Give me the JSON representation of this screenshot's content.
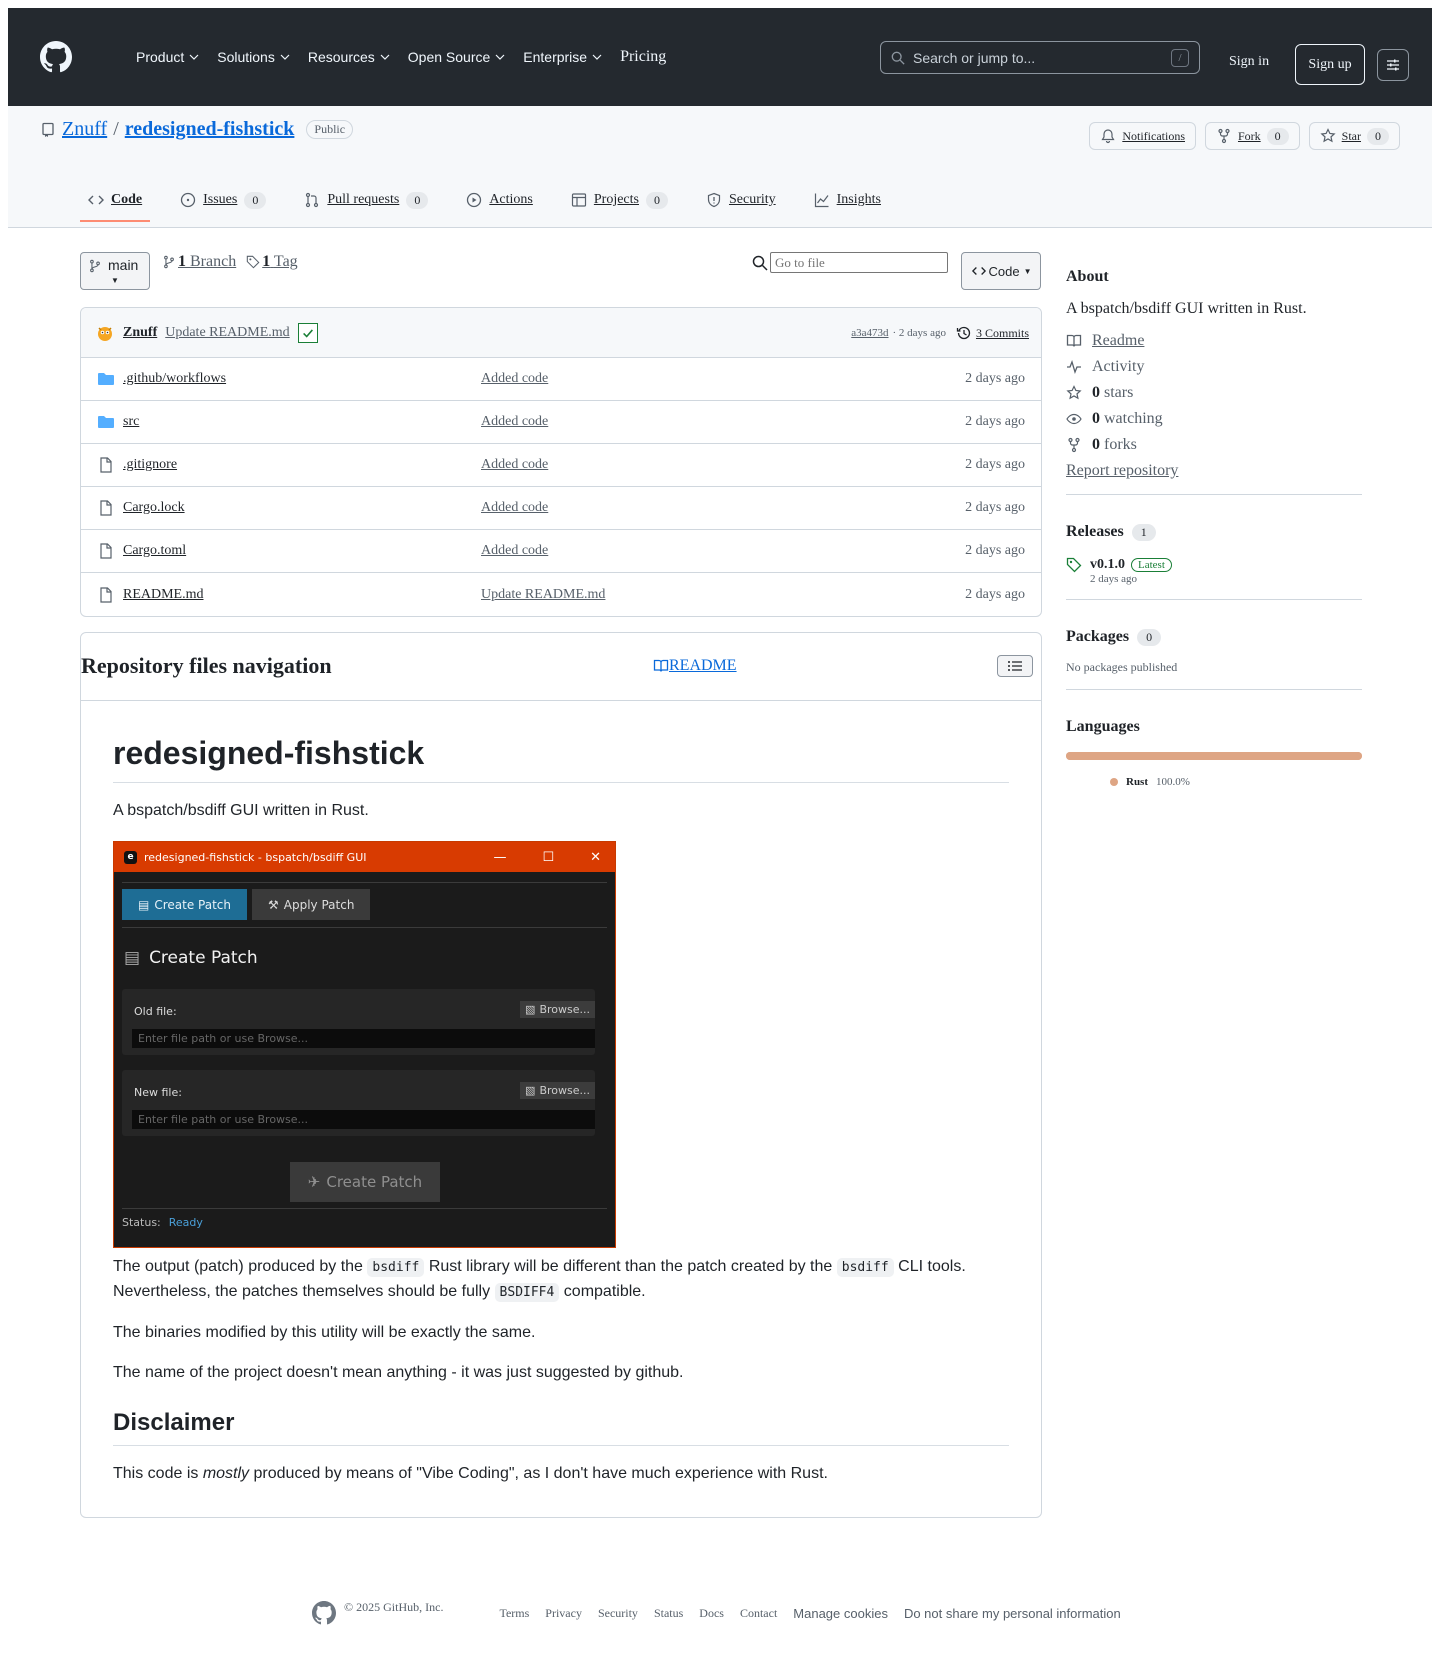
{
  "header": {
    "nav": [
      "Product",
      "Solutions",
      "Resources",
      "Open Source",
      "Enterprise"
    ],
    "pricing": "Pricing",
    "search_placeholder": "Search or jump to...",
    "search_shortcut": "/",
    "sign_in": "Sign in",
    "sign_up": "Sign up"
  },
  "repo": {
    "owner": "Znuff",
    "separator": "/",
    "name": "redesigned-fishstick",
    "visibility": "Public",
    "actions": {
      "notifications": "Notifications",
      "fork": "Fork",
      "fork_count": "0",
      "star": "Star",
      "star_count": "0"
    },
    "tabs": [
      {
        "label": "Code",
        "count": ""
      },
      {
        "label": "Issues",
        "count": "0"
      },
      {
        "label": "Pull requests",
        "count": "0"
      },
      {
        "label": "Actions",
        "count": ""
      },
      {
        "label": "Projects",
        "count": "0"
      },
      {
        "label": "Security",
        "count": ""
      },
      {
        "label": "Insights",
        "count": ""
      }
    ]
  },
  "browser": {
    "branch": "main",
    "branches_count": "1",
    "branches_label": "Branch",
    "tags_count": "1",
    "tags_label": "Tag",
    "goto_placeholder": "Go to file",
    "code_button": "Code",
    "commit": {
      "author": "Znuff",
      "message": "Update README.md",
      "sha": "a3a473d",
      "age": "· 2 days ago",
      "commits": "3 Commits"
    },
    "files": [
      {
        "name": ".github/workflows",
        "type": "dir",
        "message": "Added code",
        "age": "2 days ago"
      },
      {
        "name": "src",
        "type": "dir",
        "message": "Added code",
        "age": "2 days ago"
      },
      {
        "name": ".gitignore",
        "type": "file",
        "message": "Added code",
        "age": "2 days ago"
      },
      {
        "name": "Cargo.lock",
        "type": "file",
        "message": "Added code",
        "age": "2 days ago"
      },
      {
        "name": "Cargo.toml",
        "type": "file",
        "message": "Added code",
        "age": "2 days ago"
      },
      {
        "name": "README.md",
        "type": "file",
        "message": "Update README.md",
        "age": "2 days ago"
      }
    ]
  },
  "readme": {
    "nav_title": "Repository files navigation",
    "nav_link": "README",
    "title": "redesigned-fishstick",
    "intro": "A bspatch/bsdiff GUI written in Rust.",
    "p1_a": "The output (patch) produced by the",
    "p1_code1": "bsdiff",
    "p1_b": "Rust library will be different than the patch created by the",
    "p1_code2": "bsdiff",
    "p1_c": "CLI tools.",
    "p1_d": "Nevertheless, the patches themselves should be fully",
    "p1_code3": "BSDIFF4",
    "p1_e": "compatible.",
    "p2": "The binaries modified by this utility will be exactly the same.",
    "p3": "The name of the project doesn't mean anything - it was just suggested by github.",
    "h2": "Disclaimer",
    "p4_a": "This code is",
    "p4_em": "mostly",
    "p4_b": "produced by means of \"Vibe Coding\", as I don't have much experience with Rust."
  },
  "screenshot": {
    "app_icon": "e",
    "window_title": "redesigned-fishstick - bspatch/bsdiff GUI",
    "tab_create": "Create Patch",
    "tab_apply": "Apply Patch",
    "heading": "Create Patch",
    "old_label": "Old file:",
    "new_label": "New file:",
    "browse": "Browse...",
    "input_placeholder": "Enter file path or use Browse...",
    "create_button": "Create Patch",
    "status_label": "Status:",
    "status_value": "Ready"
  },
  "sidebar": {
    "about_title": "About",
    "description": "A bspatch/bsdiff GUI written in Rust.",
    "readme": "Readme",
    "activity": "Activity",
    "stars_count": "0",
    "stars_label": "stars",
    "watching_count": "0",
    "watching_label": "watching",
    "forks_count": "0",
    "forks_label": "forks",
    "report": "Report repository",
    "releases_title": "Releases",
    "releases_count": "1",
    "release_version": "v0.1.0",
    "release_badge": "Latest",
    "release_date": "2 days ago",
    "packages_title": "Packages",
    "packages_count": "0",
    "packages_empty": "No packages published",
    "languages_title": "Languages",
    "language_name": "Rust",
    "language_pct": "100.0%",
    "language_fraction": 1.0,
    "language_color": "#dea584"
  },
  "footer": {
    "copyright": "© 2025 GitHub, Inc.",
    "links": [
      "Terms",
      "Privacy",
      "Security",
      "Status",
      "Docs",
      "Contact"
    ],
    "manage_cookies": "Manage cookies",
    "do_not_share": "Do not share my personal information"
  }
}
